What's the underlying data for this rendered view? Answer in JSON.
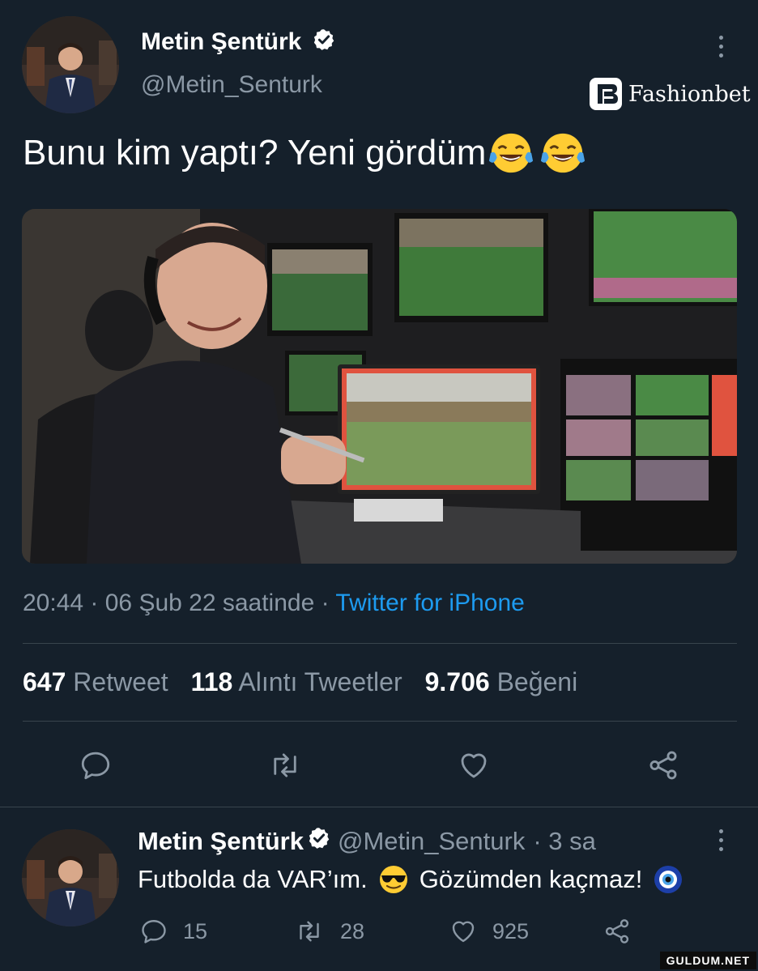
{
  "tweet": {
    "author_name": "Metin Şentürk",
    "author_handle": "@Metin_Senturk",
    "text": "Bunu kim yaptı? Yeni gördüm",
    "emojis": [
      "face-with-tears-of-joy",
      "face-with-tears-of-joy"
    ],
    "timestamp": "20:44 · 06 Şub 22 saatinde · ",
    "source": "Twitter for iPhone",
    "stats": [
      {
        "count": "647",
        "label": "Retweet"
      },
      {
        "count": "118",
        "label": "Alıntı Tweetler"
      },
      {
        "count": "9.706",
        "label": "Beğeni"
      }
    ],
    "actions": [
      "reply-icon",
      "retweet-icon",
      "like-icon",
      "share-icon"
    ]
  },
  "brand_watermark": "Fashionbet",
  "reply": {
    "author_name": "Metin Şentürk",
    "author_handle": "@Metin_Senturk",
    "time": "· 3 sa",
    "text_a": "Futbolda da VAR’ım.",
    "text_b": "Gözümden kaçmaz!",
    "emojis": [
      "smiling-face-with-sunglasses",
      "nazar-amulet"
    ],
    "reply_count": "15",
    "retweet_count": "28",
    "like_count": "925"
  },
  "site_watermark": "GULDUM.NET",
  "colors": {
    "background": "#15202b",
    "link": "#1d9bf0",
    "muted": "#8b98a5",
    "divider": "#38444d"
  }
}
